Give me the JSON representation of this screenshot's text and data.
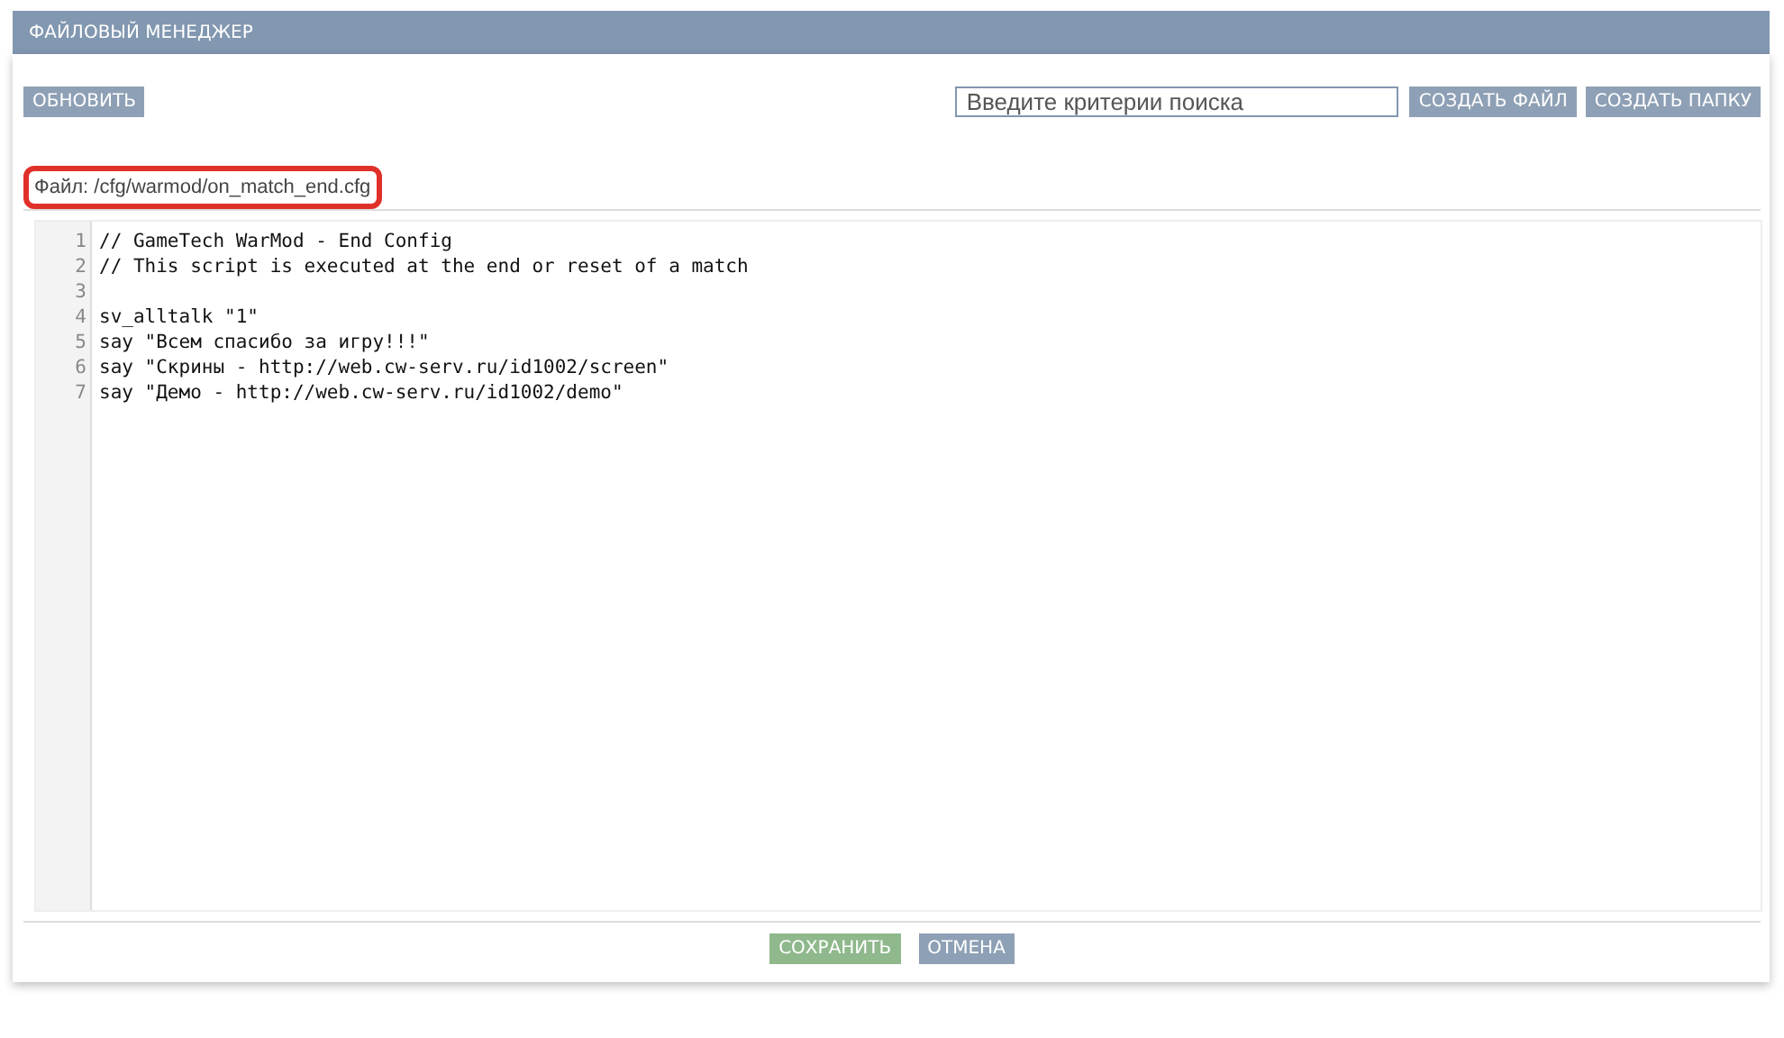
{
  "panel": {
    "title": "ФАЙЛОВЫЙ МЕНЕДЖЕР"
  },
  "toolbar": {
    "refresh_button": "ОБНОВИТЬ",
    "search": {
      "placeholder": "Введите критерии поиска"
    },
    "buttons": [
      "СОЗДАТЬ ФАЙЛ",
      "СОЗДАТЬ ПАПКУ"
    ]
  },
  "file_path": {
    "text": "Файл: /cfg/warmod/on_match_end.cfg",
    "highlighted": true
  },
  "editor": {
    "lines": [
      {
        "number": "1",
        "text": "// GameTech WarMod - End Config"
      },
      {
        "number": "2",
        "text": "// This script is executed at the end or reset of a match"
      },
      {
        "number": "3"
      },
      {
        "number": "4",
        "text": "sv_alltalk \"1\""
      },
      {
        "number": "5",
        "text": "say \"Всем спасибо за игру!!!\""
      },
      {
        "number": "6",
        "text": "say \"Скрины - http://web.cw-serv.ru/id1002/screen\""
      },
      {
        "number": "7",
        "text": "say \"Демо - http://web.cw-serv.ru/id1002/demo\""
      }
    ]
  },
  "footer": {
    "buttons": [
      {
        "label": "СОХРАНИТЬ",
        "kind": "save"
      },
      {
        "label": "ОТМЕНА",
        "kind": "cancel"
      }
    ]
  }
}
